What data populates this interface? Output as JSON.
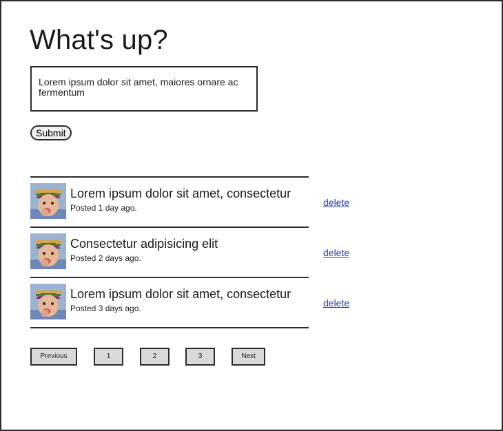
{
  "page": {
    "title": "What's up?",
    "status_text": "Lorem ipsum dolor sit amet, maiores ornare ac fermentum",
    "submit_label": "Submit"
  },
  "posts": [
    {
      "title": "Lorem ipsum dolor sit amet, consectetur",
      "meta": "Posted 1 day ago.",
      "delete_label": "delete",
      "avatar_icon": "baby-avatar"
    },
    {
      "title": "Consectetur adipisicing elit",
      "meta": "Posted 2 days ago.",
      "delete_label": "delete",
      "avatar_icon": "baby-avatar"
    },
    {
      "title": "Lorem ipsum dolor sit amet, consectetur",
      "meta": "Posted 3 days ago.",
      "delete_label": "delete",
      "avatar_icon": "baby-avatar"
    }
  ],
  "pagination": {
    "previous": "Previous",
    "pages": [
      "1",
      "2",
      "3"
    ],
    "next": "Next"
  },
  "colors": {
    "border": "#2b2b2b",
    "link": "#2a3b9a",
    "button_bg": "#d9d9d9"
  }
}
